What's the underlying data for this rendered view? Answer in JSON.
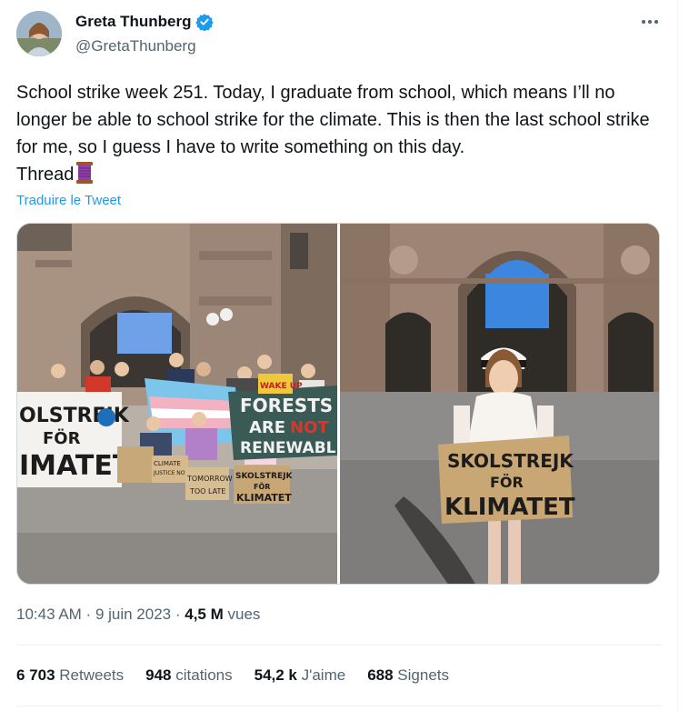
{
  "author": {
    "display_name": "Greta Thunberg",
    "handle": "@GretaThunberg",
    "verified_icon": "verified-badge-icon",
    "verified_color": "#1d9bf0"
  },
  "tweet": {
    "text": "School strike week 251. Today, I graduate from school, which means I’ll no longer be able to school strike for the climate. This is then the last school strike for me, so I guess I have to write something on this day.\nThread",
    "thread_emoji_icon": "thread-spool-icon",
    "translate_label": "Traduire le Tweet"
  },
  "media": {
    "left_photo": {
      "signs": {
        "banner_left_line1": "OLSTREJK",
        "banner_left_line2": "FÖR",
        "banner_left_line3": "IMATET",
        "forests_line1": "FORESTS",
        "forests_line2": "ARE",
        "forests_not": "NOT",
        "forests_line3": "RENEWABLE",
        "wake_up": "WAKE UP",
        "climate_justice_line1": "CLIMATE",
        "climate_justice_line2": "JUSTICE NOW",
        "tomorrow_line1": "TOMORROW IS",
        "tomorrow_line2": "TOO LATE",
        "skol_line1": "SKOLSTREJK",
        "skol_line2": "FÖR",
        "skol_line3": "KLIMATET"
      }
    },
    "right_photo": {
      "sign_line1": "SKOLSTREJK",
      "sign_line2": "FÖR",
      "sign_line3": "KLIMATET"
    }
  },
  "meta": {
    "time": "10:43 AM",
    "separator": " · ",
    "date": "9 juin 2023",
    "views_count": "4,5 M",
    "views_label": " vues"
  },
  "stats": {
    "retweets_count": "6 703",
    "retweets_label": " Retweets",
    "quotes_count": "948",
    "quotes_label": " citations",
    "likes_count": "54,2 k",
    "likes_label": " J'aime",
    "bookmarks_count": "688",
    "bookmarks_label": " Signets"
  },
  "colors": {
    "accent": "#1d9bf0",
    "text_primary": "#0f1419",
    "text_secondary": "#536471",
    "divider": "#eff3f4"
  }
}
